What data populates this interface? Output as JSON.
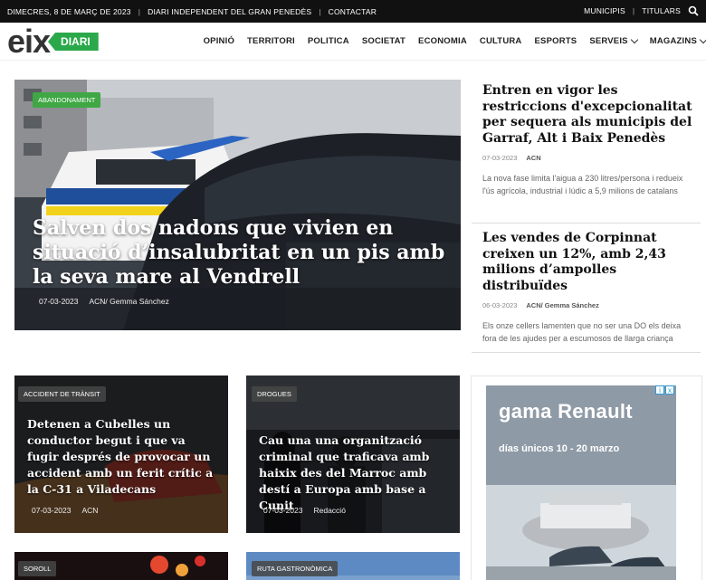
{
  "topbar": {
    "date": "DIMECRES, 8 DE MARÇ DE 2023",
    "sep": "|",
    "tagline": "DIARI INDEPENDENT DEL GRAN PENEDÈS",
    "contact": "CONTACTAR",
    "municipis": "MUNICIPIS",
    "titulars": "TITULARS"
  },
  "logo": {
    "eix": "eix",
    "diari": "DIARI"
  },
  "nav": [
    "OPINIÓ",
    "TERRITORI",
    "POLITICA",
    "SOCIETAT",
    "ECONOMIA",
    "CULTURA",
    "ESPORTS",
    "SERVEIS",
    "MAGAZINS"
  ],
  "hero": {
    "tag": "ABANDONAMENT",
    "title": "Salven dos nadons que vivien en situació d’insalubritat en un pis amb la seva mare al Vendrell",
    "date": "07-03-2023",
    "author": "ACN/ Gemma Sánchez"
  },
  "side": [
    {
      "title": "Entren en vigor les restriccions d'excepcionalitat per sequera als municipis del Garraf, Alt i Baix Penedès",
      "date": "07-03-2023",
      "author": "ACN",
      "excerpt": "La nova fase limita l'aigua a 230 litres/persona i redueix l'ús agrícola, industrial i lúdic a 5,9 milions de catalans"
    },
    {
      "title": "Les vendes de Corpinnat creixen un 12%, amb 2,43 milions d’ampolles distribuïdes",
      "date": "06-03-2023",
      "author": "ACN/ Gemma Sánchez",
      "excerpt": "Els onze cellers lamenten que no ser una DO els deixa fora de les ajudes per a escumosos de llarga criança"
    }
  ],
  "cards": [
    {
      "tag": "ACCIDENT DE TRÀNSIT",
      "title": "Detenen a Cubelles un conductor begut i que va fugir després de provocar un accident amb un ferit crític a la C-31 a Viladecans",
      "date": "07-03-2023",
      "author": "ACN"
    },
    {
      "tag": "DROGUES",
      "title": "Cau una una organització criminal que traficava amb haixix des del Marroc amb destí a Europa amb base a Cunit",
      "date": "07-03-2023",
      "author": "Redacció"
    },
    {
      "tag": "SOROLL"
    },
    {
      "tag": "RUTA GASTRONÒMICA"
    }
  ],
  "ad": {
    "brand": "gama Renault",
    "dates": "días únicos 10 - 20 marzo",
    "choices": [
      "i",
      "x"
    ]
  },
  "colors": {
    "accent": "#3fa744",
    "topbar": "#111111"
  }
}
